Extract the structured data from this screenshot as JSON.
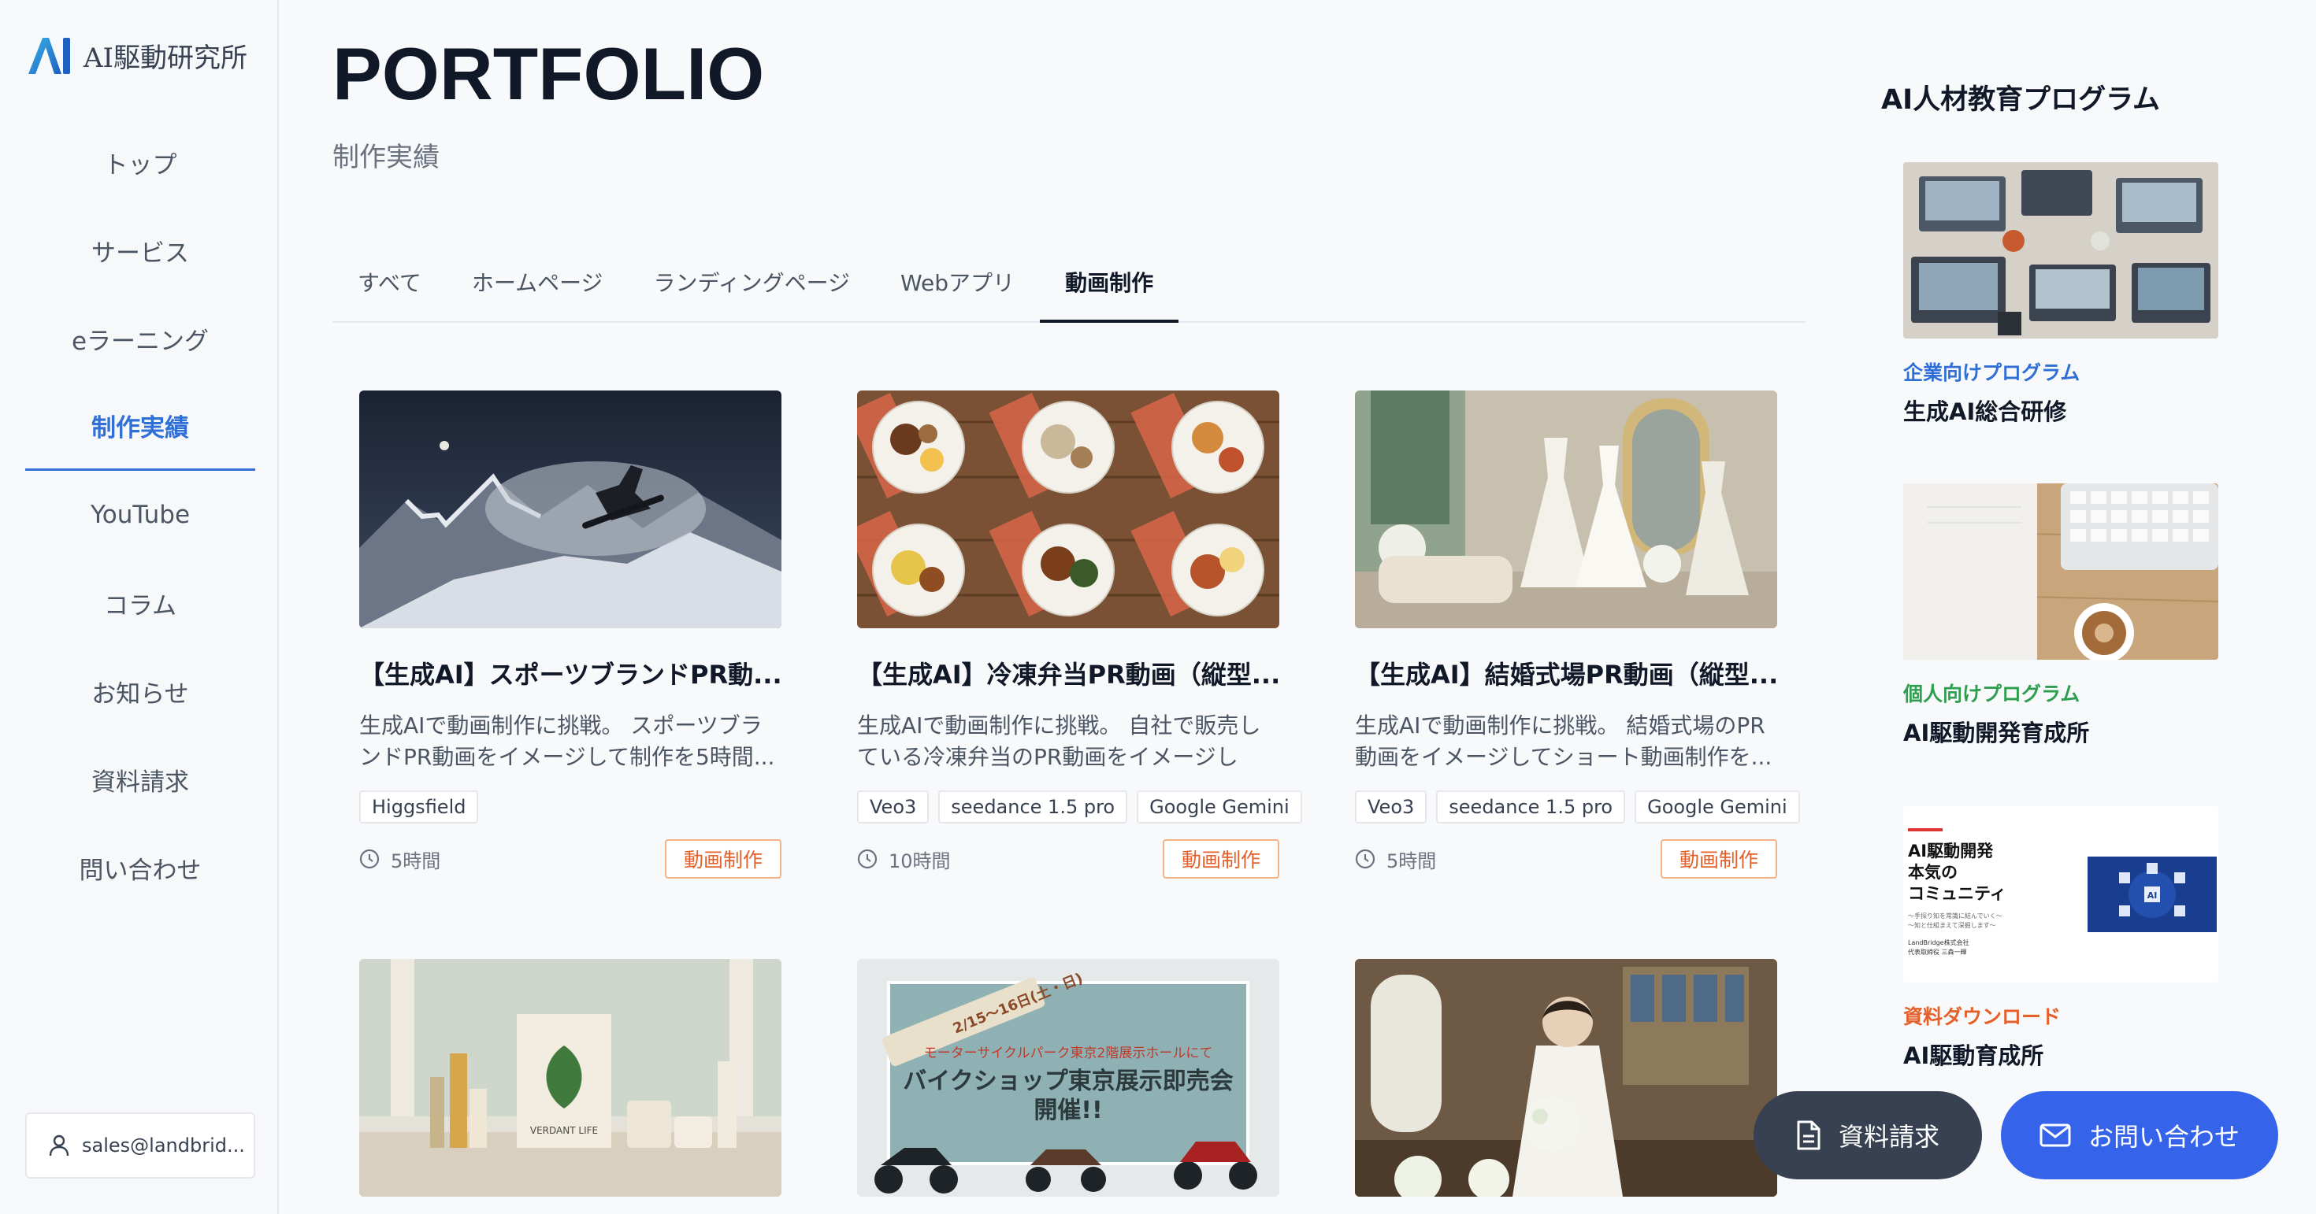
{
  "brand": {
    "name": "AI駆動研究所",
    "mark": "AI"
  },
  "nav": [
    {
      "label": "トップ"
    },
    {
      "label": "サービス"
    },
    {
      "label": "eラーニング"
    },
    {
      "label": "制作実績",
      "active": true
    },
    {
      "label": "YouTube"
    },
    {
      "label": "コラム"
    },
    {
      "label": "お知らせ"
    },
    {
      "label": "資料請求"
    },
    {
      "label": "問い合わせ"
    }
  ],
  "user": {
    "email": "sales@landbrid..."
  },
  "page": {
    "title": "PORTFOLIO",
    "subtitle": "制作実績"
  },
  "tabs": [
    {
      "label": "すべて"
    },
    {
      "label": "ホームページ"
    },
    {
      "label": "ランディングページ"
    },
    {
      "label": "Webアプリ"
    },
    {
      "label": "動画制作",
      "active": true
    }
  ],
  "cards": [
    {
      "title": "【生成AI】スポーツブランドPR動...",
      "desc": "生成AIで動画制作に挑戦。 スポーツブランドPR動画をイメージして制作を5時間...",
      "tags": [
        "Higgsfield"
      ],
      "duration": "5時間",
      "category": "動画制作"
    },
    {
      "title": "【生成AI】冷凍弁当PR動画（縦型...",
      "desc": "生成AIで動画制作に挑戦。 自社で販売している冷凍弁当のPR動画をイメージして...",
      "tags": [
        "Veo3",
        "seedance 1.5 pro",
        "Google Gemini"
      ],
      "duration": "10時間",
      "category": "動画制作"
    },
    {
      "title": "【生成AI】結婚式場PR動画（縦型...",
      "desc": "生成AIで動画制作に挑戦。 結婚式場のPR動画をイメージしてショート動画制作を...",
      "tags": [
        "Veo3",
        "seedance 1.5 pro",
        "Google Gemini"
      ],
      "duration": "5時間",
      "category": "動画制作"
    }
  ],
  "thumbs_row2": {
    "cosmetic_brand": "VERDANT LIFE",
    "bike_sub": "モーターサイクルパーク東京2階展示ホールにて",
    "bike_title": "バイクショップ東京展示即売会",
    "bike_title2": "開催!!",
    "bike_date": "2/15〜16日(土・日)"
  },
  "right_panel": {
    "title": "AI人材教育プログラム",
    "promos": [
      {
        "tag": "企業向けプログラム",
        "tag_color": "#2f6fd6",
        "name": "生成AI総合研修"
      },
      {
        "tag": "個人向けプログラム",
        "tag_color": "#2e9e4f",
        "name": "AI駆動開発育成所"
      },
      {
        "tag": "資料ダウンロード",
        "tag_color": "#e4602a",
        "name": "AI駆動育成所"
      }
    ],
    "doc_thumb": {
      "line1": "AI駆動開発",
      "line2": "本気の",
      "line3": "コミュニティ",
      "small1": "〜手探り知を常識に結んでいく〜",
      "small2": "〜知と仕組まえて深掘します〜",
      "company": "LandBridge株式会社",
      "rep": "代表取締役 三森一輝"
    }
  },
  "fab": {
    "doc_label": "資料請求",
    "mail_label": "お問い合わせ"
  }
}
